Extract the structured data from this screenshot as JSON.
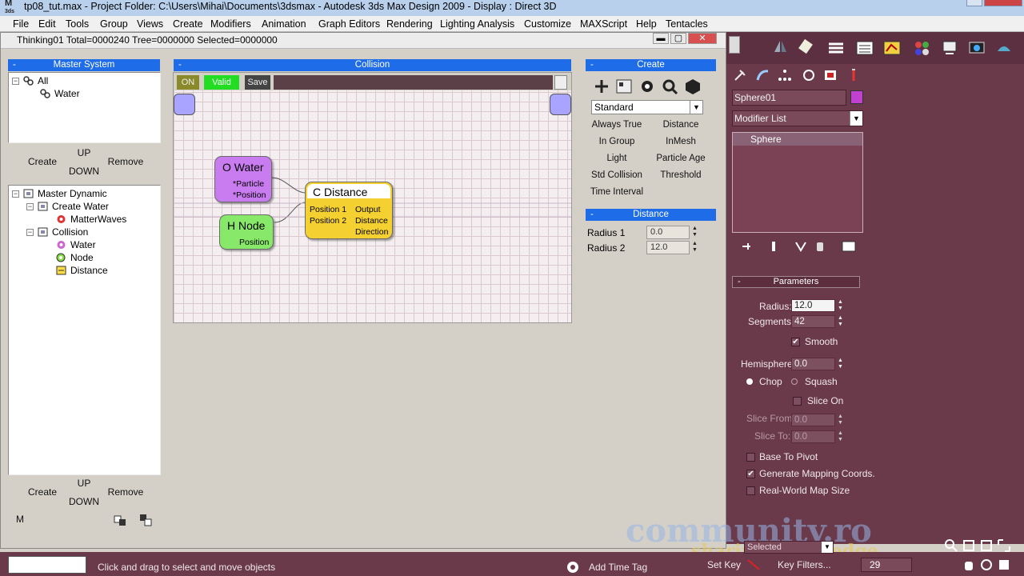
{
  "window": {
    "title": "tp08_tut.max     - Project Folder: C:\\Users\\Mihai\\Documents\\3dsmax     - Autodesk 3ds Max Design 2009          - Display : Direct 3D",
    "logo_text": "3ds"
  },
  "menubar": {
    "items": [
      "File",
      "Edit",
      "Tools",
      "Group",
      "Views",
      "Create",
      "Modifiers",
      "Animation",
      "Graph Editors",
      "Rendering",
      "Lighting Analysis",
      "Customize",
      "MAXScript",
      "Help",
      "Tentacles"
    ]
  },
  "thinking": {
    "title": "Thinking01  Total=0000240  Tree=0000000  Selected=0000000",
    "master_system": {
      "header": "Master System",
      "tree": [
        {
          "label": "All",
          "icon": "gear-group-icon"
        },
        {
          "label": "Water",
          "icon": "gear-group-icon"
        }
      ],
      "create": "Create",
      "up": "UP",
      "down": "DOWN",
      "remove": "Remove"
    },
    "master_dynamic": {
      "tree": [
        {
          "label": "Master Dynamic",
          "icon": "dynamic-folder-icon"
        },
        {
          "label": "Create Water",
          "icon": "dynamic-folder-icon"
        },
        {
          "label": "MatterWaves",
          "icon": "matterwaves-icon"
        },
        {
          "label": "Collision",
          "icon": "dynamic-folder-icon"
        },
        {
          "label": "Water",
          "icon": "water-group-icon"
        },
        {
          "label": "Node",
          "icon": "node-icon"
        },
        {
          "label": "Distance",
          "icon": "distance-icon"
        }
      ],
      "create": "Create",
      "up": "UP",
      "down": "DOWN",
      "remove": "Remove",
      "m": "M"
    },
    "collision": {
      "header": "Collision",
      "on": "ON",
      "valid": "Valid",
      "save": "Save",
      "nodes": {
        "water": {
          "title": "O Water",
          "outputs": [
            "*Particle",
            "*Position"
          ]
        },
        "hnode": {
          "title": "H Node",
          "outputs": [
            "Position"
          ]
        },
        "distance": {
          "title": "C Distance",
          "inputs": [
            "Position 1",
            "Position 2"
          ],
          "outputs": [
            "Output",
            "Distance",
            "Direction"
          ]
        }
      }
    },
    "create_panel": {
      "header": "Create",
      "dropdown": "Standard",
      "buttons": [
        [
          "Always True",
          "Distance"
        ],
        [
          "In Group",
          "InMesh"
        ],
        [
          "Light",
          "Particle Age"
        ],
        [
          "Std Collision",
          "Threshold"
        ],
        [
          "Time Interval"
        ]
      ]
    },
    "distance_panel": {
      "header": "Distance",
      "radius1_label": "Radius 1",
      "radius1": "0.0",
      "radius2_label": "Radius 2",
      "radius2": "12.0"
    }
  },
  "modify_panel": {
    "object_name": "Sphere01",
    "object_color": "#c040d0",
    "modifier_list": "Modifier List",
    "stack": [
      "Sphere"
    ],
    "parameters": {
      "header": "Parameters",
      "radius_label": "Radius:",
      "radius": "12.0",
      "segments_label": "Segments:",
      "segments": "42",
      "smooth": "Smooth",
      "hemisphere_label": "Hemisphere:",
      "hemisphere": "0.0",
      "chop": "Chop",
      "squash": "Squash",
      "slice_on": "Slice On",
      "slice_from_label": "Slice From:",
      "slice_from": "0.0",
      "slice_to_label": "Slice To:",
      "slice_to": "0.0",
      "base_to_pivot": "Base To Pivot",
      "gen_mapping": "Generate Mapping Coords.",
      "real_world": "Real-World Map Size"
    }
  },
  "statusbar": {
    "hint": "Click and drag to select and move objects",
    "add_time_tag": "Add Time Tag",
    "set_key": "Set Key",
    "key_filters": "Key Filters...",
    "selected": "Selected",
    "frame": "29"
  },
  "watermark": {
    "brand": "community.ro",
    "tagline": "sharing knowledge"
  }
}
